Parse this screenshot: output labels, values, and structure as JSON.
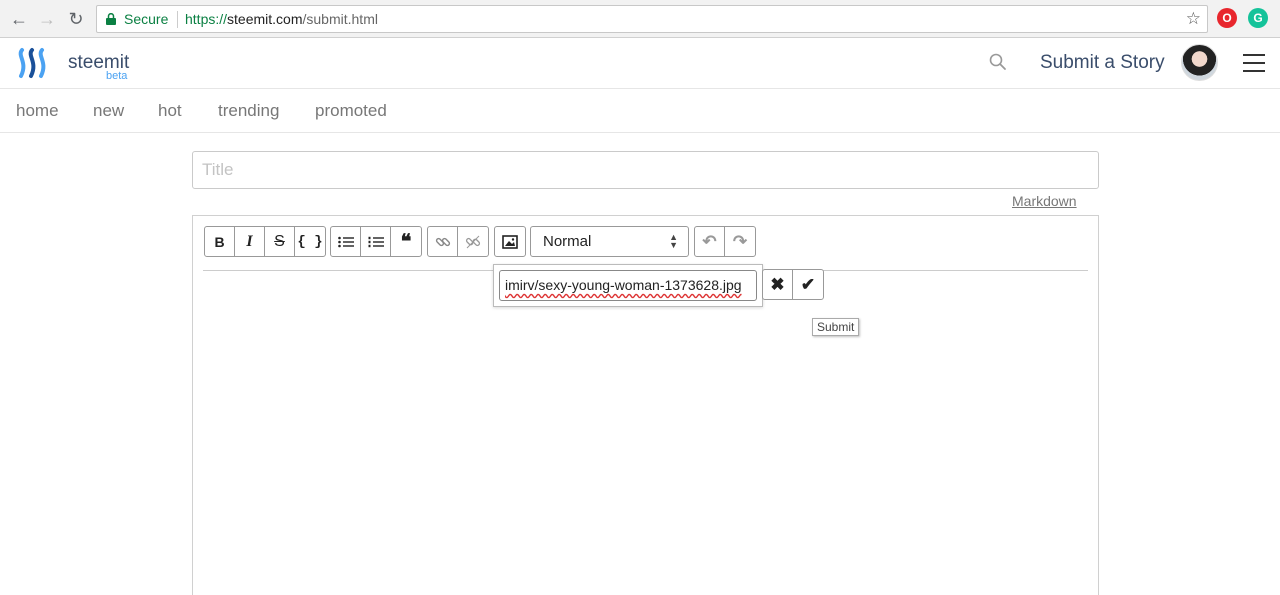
{
  "browser": {
    "secure_label": "Secure",
    "url_scheme": "https://",
    "url_host": "steemit.com",
    "url_path": "/submit.html",
    "extensions": [
      {
        "name": "opera-icon",
        "letter": "O",
        "color": "#e8262d"
      },
      {
        "name": "grammarly-icon",
        "letter": "G",
        "color": "#15c39a"
      }
    ]
  },
  "header": {
    "brand": "steemit",
    "beta": "beta",
    "submit_story": "Submit a Story"
  },
  "subnav": {
    "items": [
      "home",
      "new",
      "hot",
      "trending",
      "promoted"
    ]
  },
  "editor": {
    "title_placeholder": "Title",
    "markdown_link": "Markdown",
    "format_select": "Normal",
    "image_url_value": "imirv/sexy-young-woman-1373628.jpg",
    "tooltip": "Submit"
  },
  "colors": {
    "accent": "#4ba2f2",
    "brand_text": "#3a4d6b",
    "secure_green": "#0b8043"
  }
}
